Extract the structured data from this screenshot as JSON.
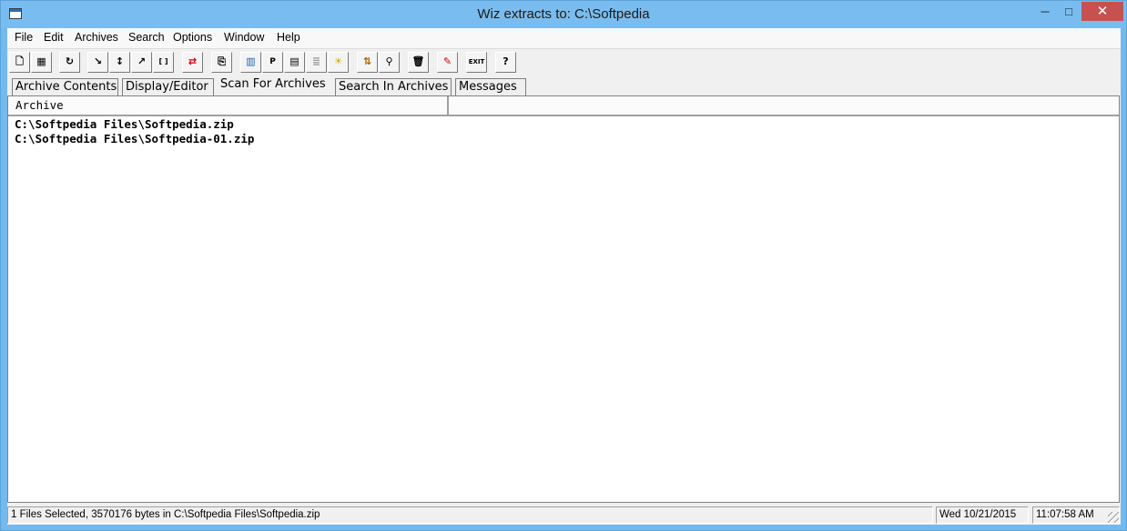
{
  "window": {
    "title": "Wiz extracts to: C:\\Softpedia",
    "controls": {
      "minimize": "─",
      "maximize": "□",
      "close": "✕"
    }
  },
  "menu": [
    "File",
    "Edit",
    "Archives",
    "Search",
    "Options",
    "Window",
    "Help"
  ],
  "toolbar": {
    "buttons": [
      {
        "icon": "new-document-icon",
        "glyph": "🗋"
      },
      {
        "icon": "open-archive-icon",
        "glyph": "▦"
      },
      {
        "icon": "refresh-icon",
        "glyph": "↻"
      },
      {
        "icon": "extract-dir-icon",
        "glyph": "↘"
      },
      {
        "icon": "extract-all-icon",
        "glyph": "↕"
      },
      {
        "icon": "extract-selected-icon",
        "glyph": "↗"
      },
      {
        "icon": "bracket-icon",
        "glyph": "[ ]"
      },
      {
        "icon": "convert-icon",
        "glyph": "⇄"
      },
      {
        "icon": "copy-icon",
        "glyph": "⎘"
      },
      {
        "icon": "view-icon",
        "glyph": "▥"
      },
      {
        "icon": "pdf-icon",
        "glyph": "P"
      },
      {
        "icon": "film-icon",
        "glyph": "▤"
      },
      {
        "icon": "text-file-icon",
        "glyph": "≣"
      },
      {
        "icon": "lightbulb-icon",
        "glyph": "☀"
      },
      {
        "icon": "sort-icon",
        "glyph": "⇅"
      },
      {
        "icon": "search-icon",
        "glyph": "⚲"
      },
      {
        "icon": "delete-icon",
        "glyph": "🗑"
      },
      {
        "icon": "edit-icon",
        "glyph": "✎"
      },
      {
        "icon": "exit-icon",
        "glyph": "EXIT"
      },
      {
        "icon": "help-icon",
        "glyph": "?"
      }
    ]
  },
  "tabs": [
    {
      "label": "Archive Contents",
      "active": false
    },
    {
      "label": "Display/Editor",
      "active": false
    },
    {
      "label": "Scan For Archives",
      "active": true
    },
    {
      "label": "Search In Archives",
      "active": false
    },
    {
      "label": "Messages",
      "active": false
    }
  ],
  "list": {
    "column_header": "Archive",
    "rows": [
      "C:\\Softpedia Files\\Softpedia.zip",
      "C:\\Softpedia Files\\Softpedia-01.zip"
    ]
  },
  "status": {
    "message": "1 Files Selected, 3570176 bytes in C:\\Softpedia Files\\Softpedia.zip",
    "date": "Wed 10/21/2015",
    "time": "11:07:58 AM"
  }
}
